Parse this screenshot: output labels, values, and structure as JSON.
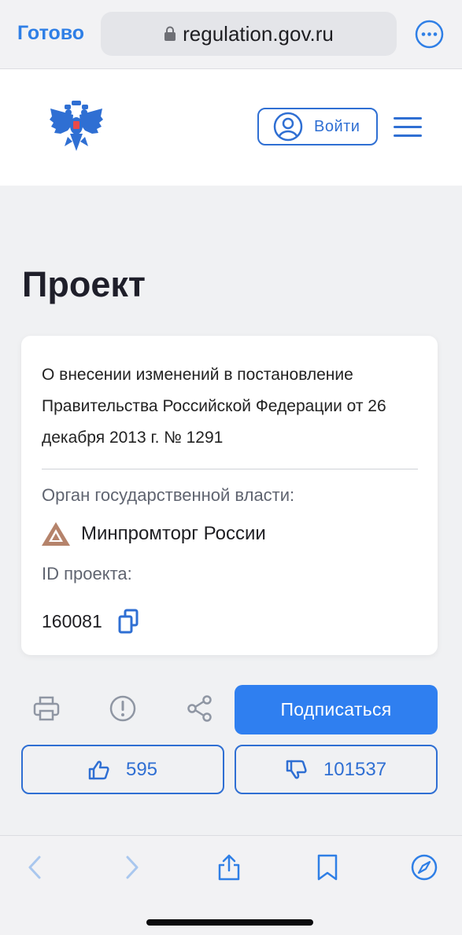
{
  "browser": {
    "done_label": "Готово",
    "url": "regulation.gov.ru"
  },
  "header": {
    "login_label": "Войти"
  },
  "page": {
    "title": "Проект"
  },
  "card": {
    "description": "О внесении изменений в постановление Правительства Российской Федерации от 26 декабря 2013 г. № 1291",
    "org_label": "Орган государственной власти:",
    "org_name": "Минпромторг России",
    "id_label": "ID проекта:",
    "id_value": "160081"
  },
  "actions": {
    "subscribe_label": "Подписаться",
    "likes": "595",
    "dislikes": "101537"
  },
  "colors": {
    "accent": "#2f7ff0",
    "accent_dark": "#2f6fd3",
    "safari_blue": "#2f7fe6",
    "background": "#f0f1f3"
  },
  "icons": [
    "lock-icon",
    "more-icon",
    "emblem-icon",
    "user-icon",
    "menu-icon",
    "ministry-logo-icon",
    "copy-icon",
    "print-icon",
    "alert-icon",
    "share-icon",
    "thumbs-up-icon",
    "thumbs-down-icon",
    "back-icon",
    "forward-icon",
    "share-sheet-icon",
    "bookmarks-icon",
    "compass-icon"
  ]
}
